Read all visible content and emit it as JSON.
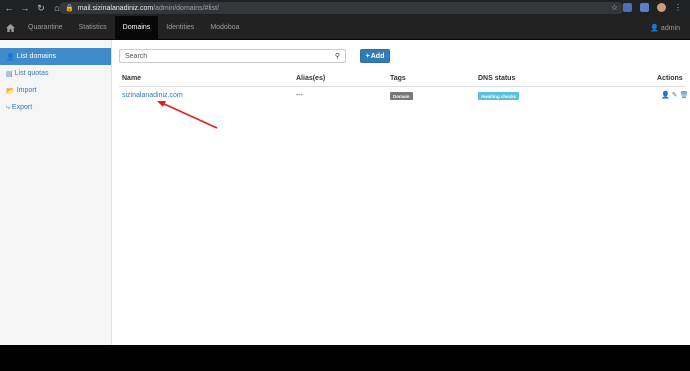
{
  "browser": {
    "url_host": "mail.sizinalanadiniz.com",
    "url_path": "/admin/domains/#list/"
  },
  "navbar": {
    "tabs": [
      {
        "label": "Quarantine"
      },
      {
        "label": "Statistics"
      },
      {
        "label": "Domains"
      },
      {
        "label": "Identities"
      },
      {
        "label": "Modoboa"
      }
    ],
    "user": "admin"
  },
  "sidebar": {
    "items": [
      {
        "label": "List domains"
      },
      {
        "label": "List quotas"
      },
      {
        "label": "Import"
      },
      {
        "label": "Export"
      }
    ]
  },
  "toolbar": {
    "search_placeholder": "Search",
    "add_label": "Add"
  },
  "table": {
    "columns": [
      "Name",
      "Alias(es)",
      "Tags",
      "DNS status",
      "Actions"
    ],
    "rows": [
      {
        "name": "sizinalanadiniz.com",
        "aliases": "---",
        "tag": "Domain",
        "dns_status": "Awaiting checks"
      }
    ]
  },
  "colors": {
    "navbar_bg": "#222222",
    "primary": "#337ab7",
    "sidebar_active": "#428bca",
    "tag_domain": "#777777",
    "tag_dns": "#5bc0de",
    "annotation_arrow": "#e02020"
  }
}
